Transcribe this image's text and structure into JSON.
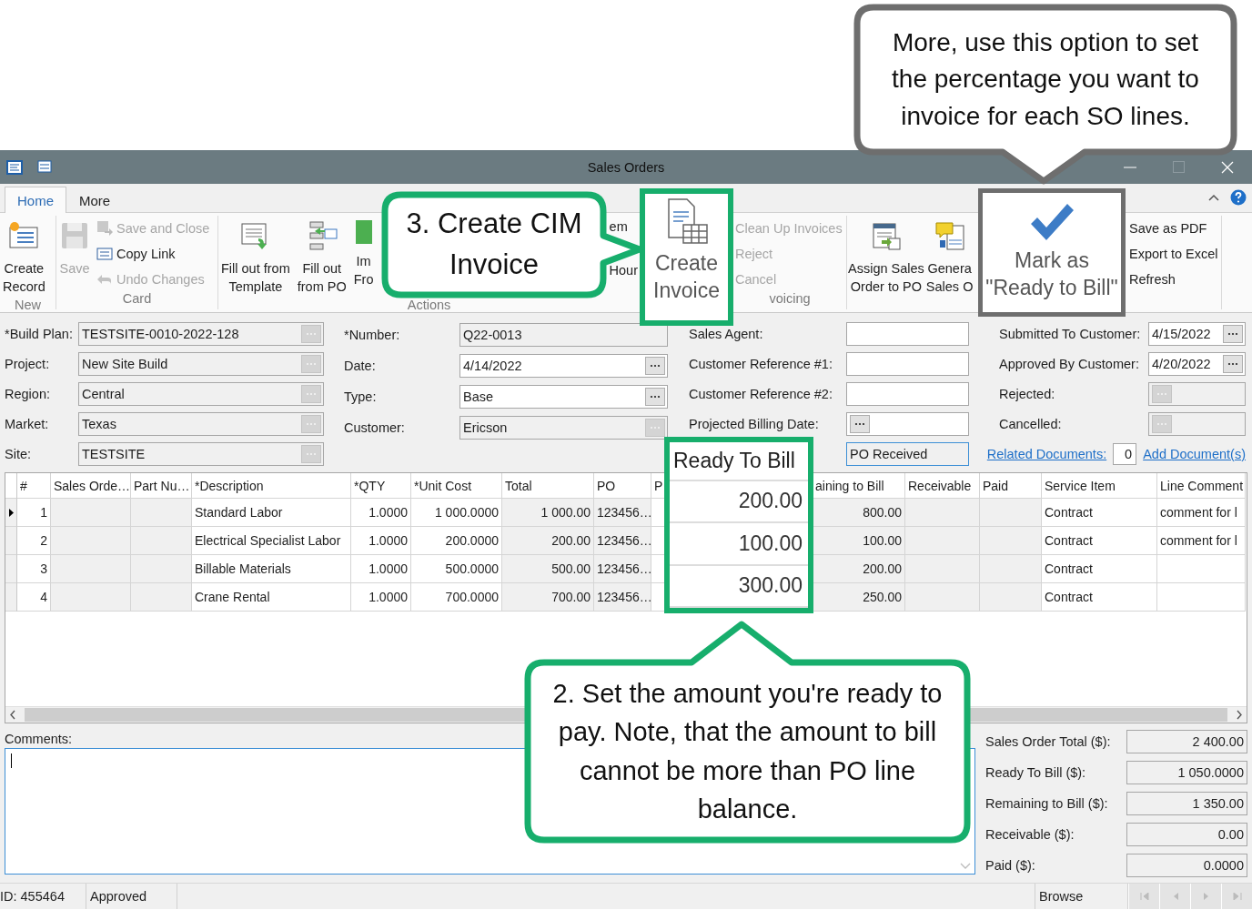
{
  "window": {
    "title": "Sales Orders"
  },
  "ribbon_tabs": [
    {
      "label": "Home",
      "selected": true
    },
    {
      "label": "More",
      "selected": false
    }
  ],
  "ribbon_groups": [
    {
      "label": "New",
      "large_buttons": [
        {
          "label": "Create\nRecord",
          "disabled": false
        }
      ]
    },
    {
      "label": "Card",
      "large_buttons": [
        {
          "label": "Save",
          "disabled": true
        }
      ],
      "small_buttons": [
        {
          "label": "Save and Close",
          "disabled": true
        },
        {
          "label": "Copy Link",
          "disabled": false
        },
        {
          "label": "Undo Changes",
          "disabled": true
        }
      ]
    },
    {
      "label": "Actions",
      "large_buttons": [
        {
          "label": "Fill out from\nTemplate",
          "disabled": false
        },
        {
          "label": "Fill out\nfrom PO",
          "disabled": false
        },
        {
          "label": "Im\nFro",
          "disabled": false
        }
      ],
      "small_buttons": [
        {
          "label": "em",
          "disabled": false
        },
        {
          "label": "Hour",
          "disabled": false
        }
      ]
    },
    {
      "label": "voicing",
      "small_buttons": [
        {
          "label": "Clean Up Invoices",
          "disabled": true
        },
        {
          "label": "Reject",
          "disabled": true
        },
        {
          "label": "Cancel",
          "disabled": true
        }
      ]
    },
    {
      "large_buttons": [
        {
          "label": "Assign Sales\nOrder to PO",
          "disabled": false
        },
        {
          "label": "Genera\nSales O",
          "disabled": false
        }
      ]
    },
    {
      "small_buttons": [
        {
          "label": "Save as PDF",
          "disabled": false
        },
        {
          "label": "Export to Excel",
          "disabled": false
        },
        {
          "label": "Refresh",
          "disabled": false
        }
      ]
    }
  ],
  "create_invoice": {
    "label": "Create\nInvoice"
  },
  "mark_ready": {
    "label": "Mark as\n\"Ready to Bill\""
  },
  "form": {
    "columns": [
      [
        {
          "label": "*Build Plan:",
          "value": "TESTSITE-0010-2022-128",
          "kind": "lookup",
          "readonly": true,
          "button_disabled": true
        },
        {
          "label": "Project:",
          "value": "New Site Build",
          "kind": "lookup",
          "readonly": true,
          "button_disabled": true
        },
        {
          "label": "Region:",
          "value": "Central",
          "kind": "lookup",
          "readonly": true,
          "button_disabled": true
        },
        {
          "label": "Market:",
          "value": "Texas",
          "kind": "lookup",
          "readonly": true,
          "button_disabled": true
        },
        {
          "label": "Site:",
          "value": "TESTSITE",
          "kind": "lookup",
          "readonly": true,
          "button_disabled": true
        }
      ],
      [
        {
          "label": "*Number:",
          "value": "Q22-0013",
          "kind": "text",
          "readonly": true
        },
        {
          "label": "Date:",
          "value": "4/14/2022",
          "kind": "lookup",
          "readonly": false,
          "button_disabled": false
        },
        {
          "label": "Type:",
          "value": "Base",
          "kind": "lookup",
          "readonly": false,
          "button_disabled": false
        },
        {
          "label": "Customer:",
          "value": "Ericson",
          "kind": "lookup",
          "readonly": true,
          "button_disabled": true
        }
      ],
      [
        {
          "label": "Sales Agent:",
          "kind": "text",
          "readonly": false
        },
        {
          "label": "Customer Reference #1:",
          "kind": "text",
          "readonly": false
        },
        {
          "label": "Customer Reference #2:",
          "kind": "text",
          "readonly": false
        },
        {
          "label": "Projected Billing Date:",
          "kind": "lookup",
          "readonly": false,
          "button_disabled": false
        },
        {
          "value": "PO Received",
          "kind": "text",
          "readonly": true
        }
      ],
      [
        {
          "label": "Submitted To Customer:",
          "value": "4/15/2022",
          "kind": "lookup",
          "readonly": false,
          "button_disabled": false
        },
        {
          "label": "Approved By Customer:",
          "value": "4/20/2022",
          "kind": "lookup",
          "readonly": false,
          "button_disabled": false
        },
        {
          "label": "Rejected:",
          "kind": "lookup",
          "readonly": true,
          "button_disabled": true
        },
        {
          "label": "Cancelled:",
          "kind": "lookup",
          "readonly": true,
          "button_disabled": true
        }
      ]
    ]
  },
  "documents": {
    "link": "Related Documents:",
    "count": "0",
    "add_link": "Add Document(s)"
  },
  "grid": {
    "columns": [
      "#",
      "Sales Orde…",
      "Part Nu…",
      "*Description",
      "*QTY",
      "*Unit Cost",
      "Total",
      "PO",
      "P",
      "aining to Bill",
      "Receivable",
      "Paid",
      "Service Item",
      "Line Comment"
    ],
    "rows": [
      {
        "selected": true,
        "number": "1",
        "description": "Standard Labor",
        "qty": "1.0000",
        "unit_cost": "1 000.0000",
        "total": "1 000.00",
        "po": "123456…",
        "remaining": "800.00",
        "service_item": "Contract",
        "line_comment": "comment for l"
      },
      {
        "selected": false,
        "number": "2",
        "description": "Electrical Specialist Labor",
        "qty": "1.0000",
        "unit_cost": "200.0000",
        "total": "200.00",
        "po": "123456…",
        "remaining": "100.00",
        "service_item": "Contract",
        "line_comment": "comment for l"
      },
      {
        "selected": false,
        "number": "3",
        "description": "Billable Materials",
        "qty": "1.0000",
        "unit_cost": "500.0000",
        "total": "500.00",
        "po": "123456…",
        "remaining": "200.00",
        "service_item": "Contract"
      },
      {
        "selected": false,
        "number": "4",
        "description": "Crane Rental",
        "qty": "1.0000",
        "unit_cost": "700.0000",
        "total": "700.00",
        "po": "123456…",
        "remaining": "250.00",
        "service_item": "Contract"
      }
    ]
  },
  "ready_to_bill_zoom": {
    "header": "Ready To Bill",
    "values": [
      "200.00",
      "100.00",
      "300.00"
    ]
  },
  "comments": {
    "label": "Comments:"
  },
  "totals": [
    {
      "label": "Sales Order Total ($):",
      "value": "2 400.00"
    },
    {
      "label": "Ready To Bill ($):",
      "value": "1 050.0000"
    },
    {
      "label": "Remaining to Bill ($):",
      "value": "1 350.00"
    },
    {
      "label": "Receivable ($):",
      "value": "0.00"
    },
    {
      "label": "Paid ($):",
      "value": "0.0000"
    }
  ],
  "status_bar": {
    "id": "ID: 455464",
    "state": "Approved",
    "mode": "Browse"
  },
  "callouts": [
    {
      "text": "More, use this option to set the percentage you want to invoice for each SO lines.",
      "color": "#6e6e6e"
    },
    {
      "text": "3. Create CIM Invoice",
      "color": "#17ae6c"
    },
    {
      "text": "2. Set the amount you're ready to pay. Note, that the amount to bill cannot be more than PO line balance.",
      "color": "#17ae6c"
    }
  ]
}
